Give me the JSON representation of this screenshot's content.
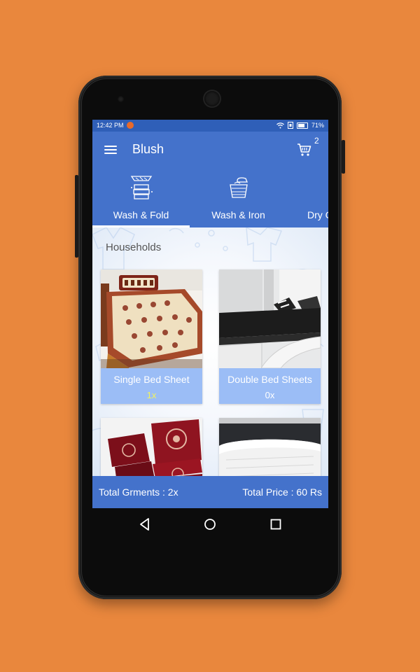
{
  "status": {
    "time": "12:42 PM",
    "battery": "71%"
  },
  "app": {
    "title": "Blush",
    "cart_count": "2"
  },
  "tabs": [
    {
      "label": "Wash & Fold",
      "icon": "folded-clothes-icon",
      "active": true
    },
    {
      "label": "Wash & Iron",
      "icon": "iron-basket-icon",
      "active": false
    },
    {
      "label": "Dry C",
      "icon": "dry-clean-icon",
      "active": false
    }
  ],
  "section": {
    "title": "Households"
  },
  "items": [
    {
      "name": "Single Bed Sheet",
      "qty": "1x"
    },
    {
      "name": "Double Bed Sheets",
      "qty": "0x"
    },
    {
      "name": "",
      "qty": ""
    },
    {
      "name": "",
      "qty": ""
    }
  ],
  "footer": {
    "garments_label": "Total Grments : 2x",
    "price_label": "Total Price : 60 Rs"
  },
  "colors": {
    "accent": "#4472cb",
    "status": "#2f5fb8",
    "card_footer": "#9bbdf6",
    "background": "#E9873D"
  }
}
